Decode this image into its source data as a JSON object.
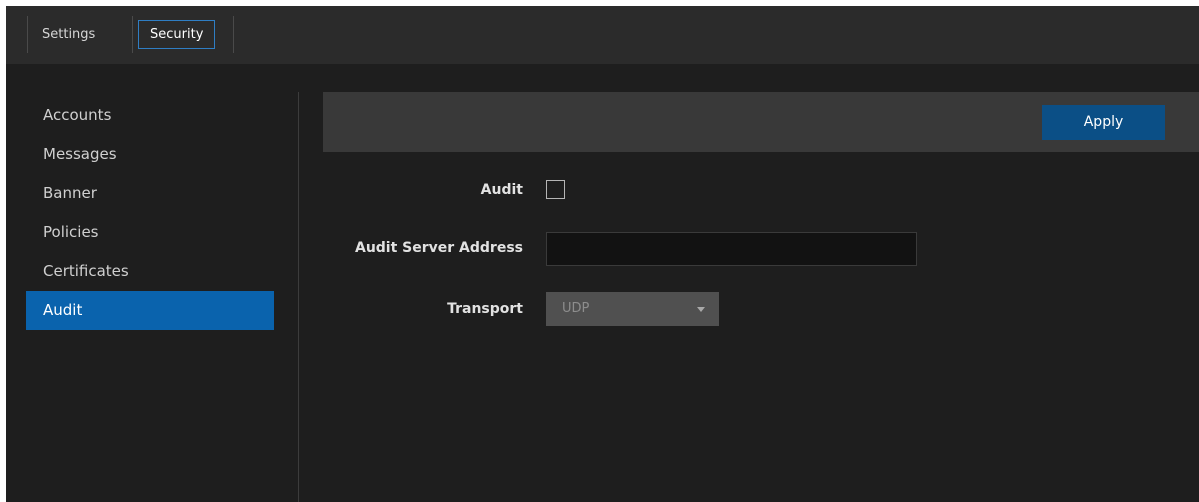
{
  "topbar": {
    "tabs": [
      {
        "label": "Settings",
        "active": false
      },
      {
        "label": "Security",
        "active": true
      }
    ]
  },
  "sidebar": {
    "items": [
      {
        "label": "Accounts"
      },
      {
        "label": "Messages"
      },
      {
        "label": "Banner"
      },
      {
        "label": "Policies"
      },
      {
        "label": "Certificates"
      },
      {
        "label": "Audit",
        "active": true
      }
    ]
  },
  "toolbar": {
    "apply_label": "Apply"
  },
  "form": {
    "audit_label": "Audit",
    "audit_checked": false,
    "server_address_label": "Audit Server Address",
    "server_address_value": "",
    "transport_label": "Transport",
    "transport_value": "UDP"
  },
  "colors": {
    "background": "#1e1e1e",
    "topbar": "#2b2b2b",
    "accent": "#0a63ad",
    "apply_button": "#0b4f86",
    "tab_border": "#2f7ec4"
  },
  "icons": {
    "transport_caret": "chevron-down-icon"
  }
}
